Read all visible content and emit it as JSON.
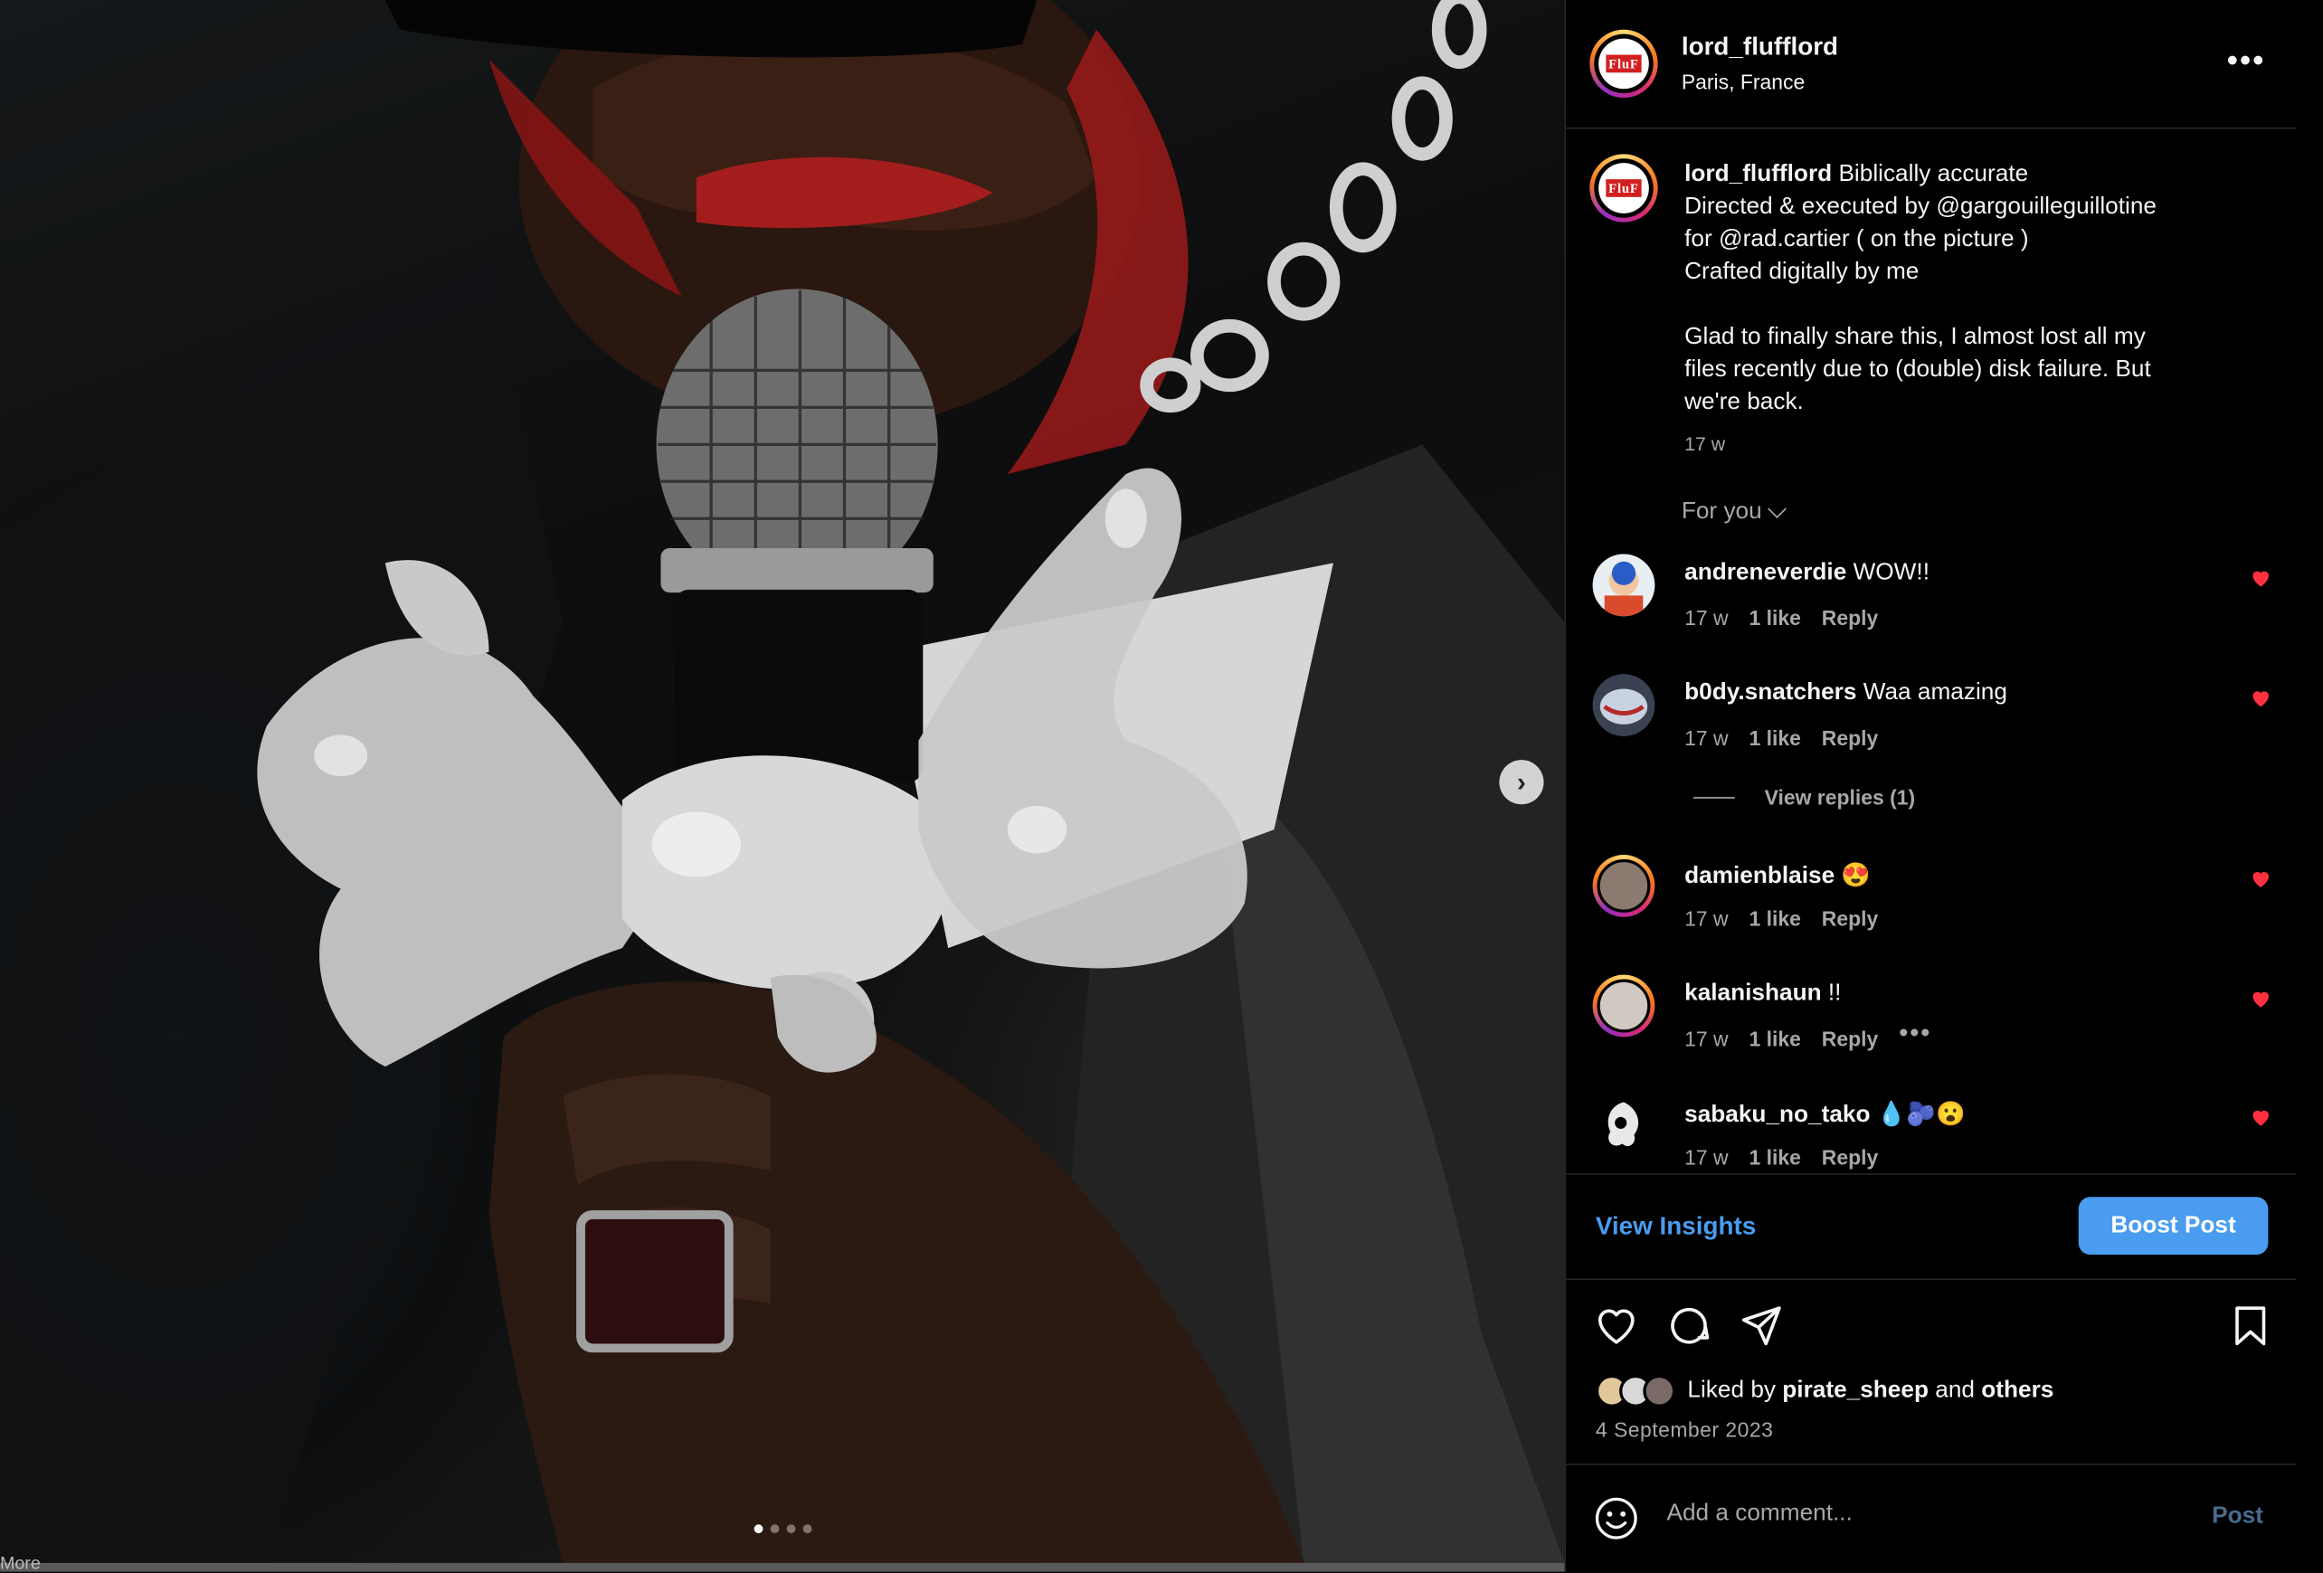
{
  "media": {
    "dots_total": 4,
    "dots_active": 1,
    "next_icon": "chevron-right-icon",
    "more_label": "More"
  },
  "header": {
    "username": "lord_flufflord",
    "location": "Paris, France",
    "more_icon": "•••",
    "logo_text": "FluF"
  },
  "caption": {
    "username": "lord_flufflord",
    "first_line": " Biblically accurate",
    "lines": [
      "Directed & executed by @gargouilleguillotine",
      "for @rad.cartier ( on the picture )",
      "Crafted digitally by me"
    ],
    "para2": [
      "Glad to finally share this, I almost lost all my",
      "files recently due to (double) disk failure. But",
      "we're back."
    ],
    "time": "17 w"
  },
  "sort": {
    "label": "For you"
  },
  "comments": [
    {
      "username": "andreneverdie",
      "text": " WOW!!",
      "time": "17 w",
      "likes": "1 like",
      "reply": "Reply"
    },
    {
      "username": "b0dy.snatchers",
      "text": " Waa amazing",
      "time": "17 w",
      "likes": "1 like",
      "reply": "Reply"
    },
    {
      "username": "damienblaise",
      "text": " 😍",
      "time": "17 w",
      "likes": "1 like",
      "reply": "Reply"
    },
    {
      "username": "kalanishaun",
      "text": " !!",
      "time": "17 w",
      "likes": "1 like",
      "reply": "Reply",
      "more": "•••"
    },
    {
      "username": "sabaku_no_tako",
      "text": " 💧🫐😮",
      "time": "17 w",
      "likes": "1 like",
      "reply": "Reply"
    }
  ],
  "view_replies": "View replies (1)",
  "insights": {
    "view_label": "View Insights",
    "boost_label": "Boost Post"
  },
  "likes": {
    "prefix": "Liked by ",
    "user": "pirate_sheep",
    "middle": " and ",
    "others": "others"
  },
  "post_date": "4 September 2023",
  "add_comment": {
    "placeholder": "Add a comment...",
    "post_label": "Post"
  },
  "colors": {
    "accent_blue": "#4a9cf0",
    "heart_red": "#ff3040",
    "muted": "#a8a8a8"
  }
}
